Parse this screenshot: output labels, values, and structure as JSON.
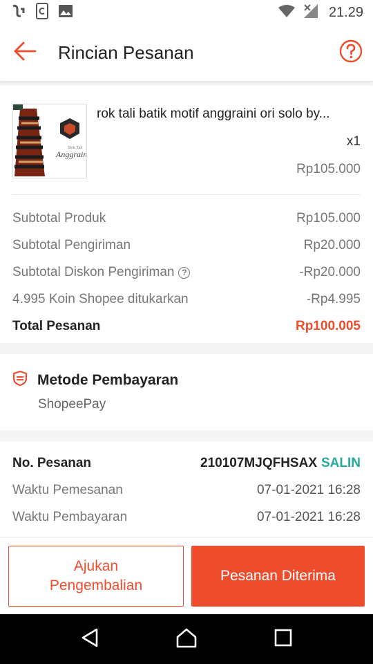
{
  "status_bar": {
    "time": "21.29"
  },
  "header": {
    "title": "Rincian Pesanan"
  },
  "product": {
    "name": "rok tali batik motif anggraini ori solo by...",
    "qty": "x1",
    "price": "Rp105.000",
    "thumb_text": "Anggraini",
    "thumb_subtext": "Rok Tali"
  },
  "summary": [
    {
      "label": "Subtotal Produk",
      "value": "Rp105.000"
    },
    {
      "label": "Subtotal Pengiriman",
      "value": "Rp20.000"
    },
    {
      "label": "Subtotal Diskon Pengiriman",
      "value": "-Rp20.000",
      "info_icon": "?"
    },
    {
      "label": "4.995 Koin Shopee ditukarkan",
      "value": "-Rp4.995"
    },
    {
      "label": "Total Pesanan",
      "value": "Rp100.005"
    }
  ],
  "payment": {
    "title": "Metode Pembayaran",
    "method": "ShopeePay"
  },
  "order": {
    "no_label": "No. Pesanan",
    "no_value": "210107MJQFHSAX",
    "copy_label": "SALIN",
    "order_time_label": "Waktu Pemesanan",
    "order_time_value": "07-01-2021 16:28",
    "pay_time_label": "Waktu Pembayaran",
    "pay_time_value": "07-01-2021 16:28"
  },
  "actions": {
    "return_line1": "Ajukan",
    "return_line2": "Pengembalian",
    "received": "Pesanan Diterima"
  },
  "colors": {
    "accent": "#ee4d2d",
    "link": "#26aa99"
  },
  "icons": [
    "app-notification-icon",
    "sync-icon",
    "image-icon",
    "wifi-icon",
    "signal-icon",
    "back-arrow-icon",
    "help-icon",
    "shield-icon",
    "back-nav-icon",
    "home-nav-icon",
    "recents-nav-icon"
  ]
}
